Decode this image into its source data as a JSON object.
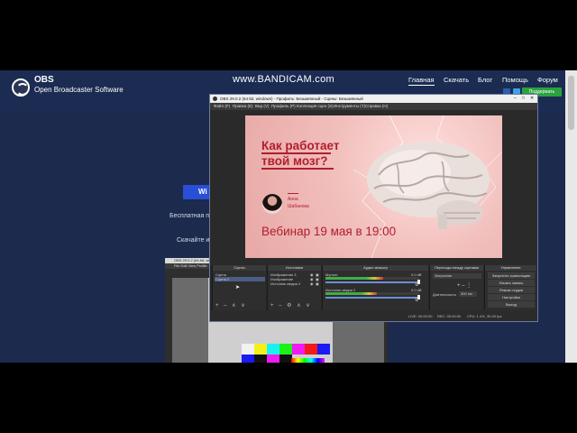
{
  "site": {
    "logo_title": "OBS",
    "logo_subtitle": "Open Broadcaster Software",
    "watermark": "www.BANDICAM.com",
    "nav": [
      "Главная",
      "Скачать",
      "Блог",
      "Помощь",
      "Форум"
    ],
    "subscribe_label": "Поддержать",
    "hero_button": "Wi",
    "hero_text1": "Бесплатная програм",
    "hero_text2": "Скачайте и"
  },
  "bg_obs": {
    "title": "OBS 29.0.2 (64-bit, windows) - Профиль: Безымянный - Сцены: Безымянный",
    "menu": "File  Edit  View  Profile"
  },
  "obs": {
    "title": "OBS 29.0.2 (64-bit, windows) - Профиль: Безымянный - Сцены: Безымянный",
    "menu": [
      "Файл (F)",
      "Правка (E)",
      "Вид (V)",
      "Профиль (P)",
      "Коллекция сцен (S)",
      "Инструменты (T)",
      "Справка (H)"
    ],
    "slide": {
      "title_line1": "Как работает",
      "title_line2": "твой мозг?",
      "speaker_first": "Анна",
      "speaker_last": "Шабанова",
      "webinar": "Вебинар 19 мая в 19:00"
    },
    "docks": {
      "scenes_header": "Сцены",
      "scenes": [
        "Сцена",
        "Сцена 2"
      ],
      "sources_header": "Источники",
      "sources": [
        "Изображение 3",
        "Изображение",
        "Источник медиа 2"
      ],
      "mixer_header": "Аудио микшер",
      "mixer_rows": [
        {
          "name": "Мульти",
          "db": "0.0 dB",
          "level": 0.62
        },
        {
          "name": "Источник медиа 2",
          "db": "0.0 dB",
          "level": 0.55
        }
      ],
      "transitions_header": "Переходы между сценами",
      "transition_value": "Затухание",
      "duration_label": "Длительность",
      "duration_value": "300 ms",
      "controls_header": "Управление",
      "controls": [
        "Запустить трансляцию",
        "Начать запись",
        "Режим студии",
        "Настройки",
        "Выход"
      ]
    },
    "status": {
      "live": "LIVE: 00:00:00",
      "rec": "REC: 00:00:00",
      "cpu": "CPU: 1.4%, 30.00 fps"
    }
  }
}
